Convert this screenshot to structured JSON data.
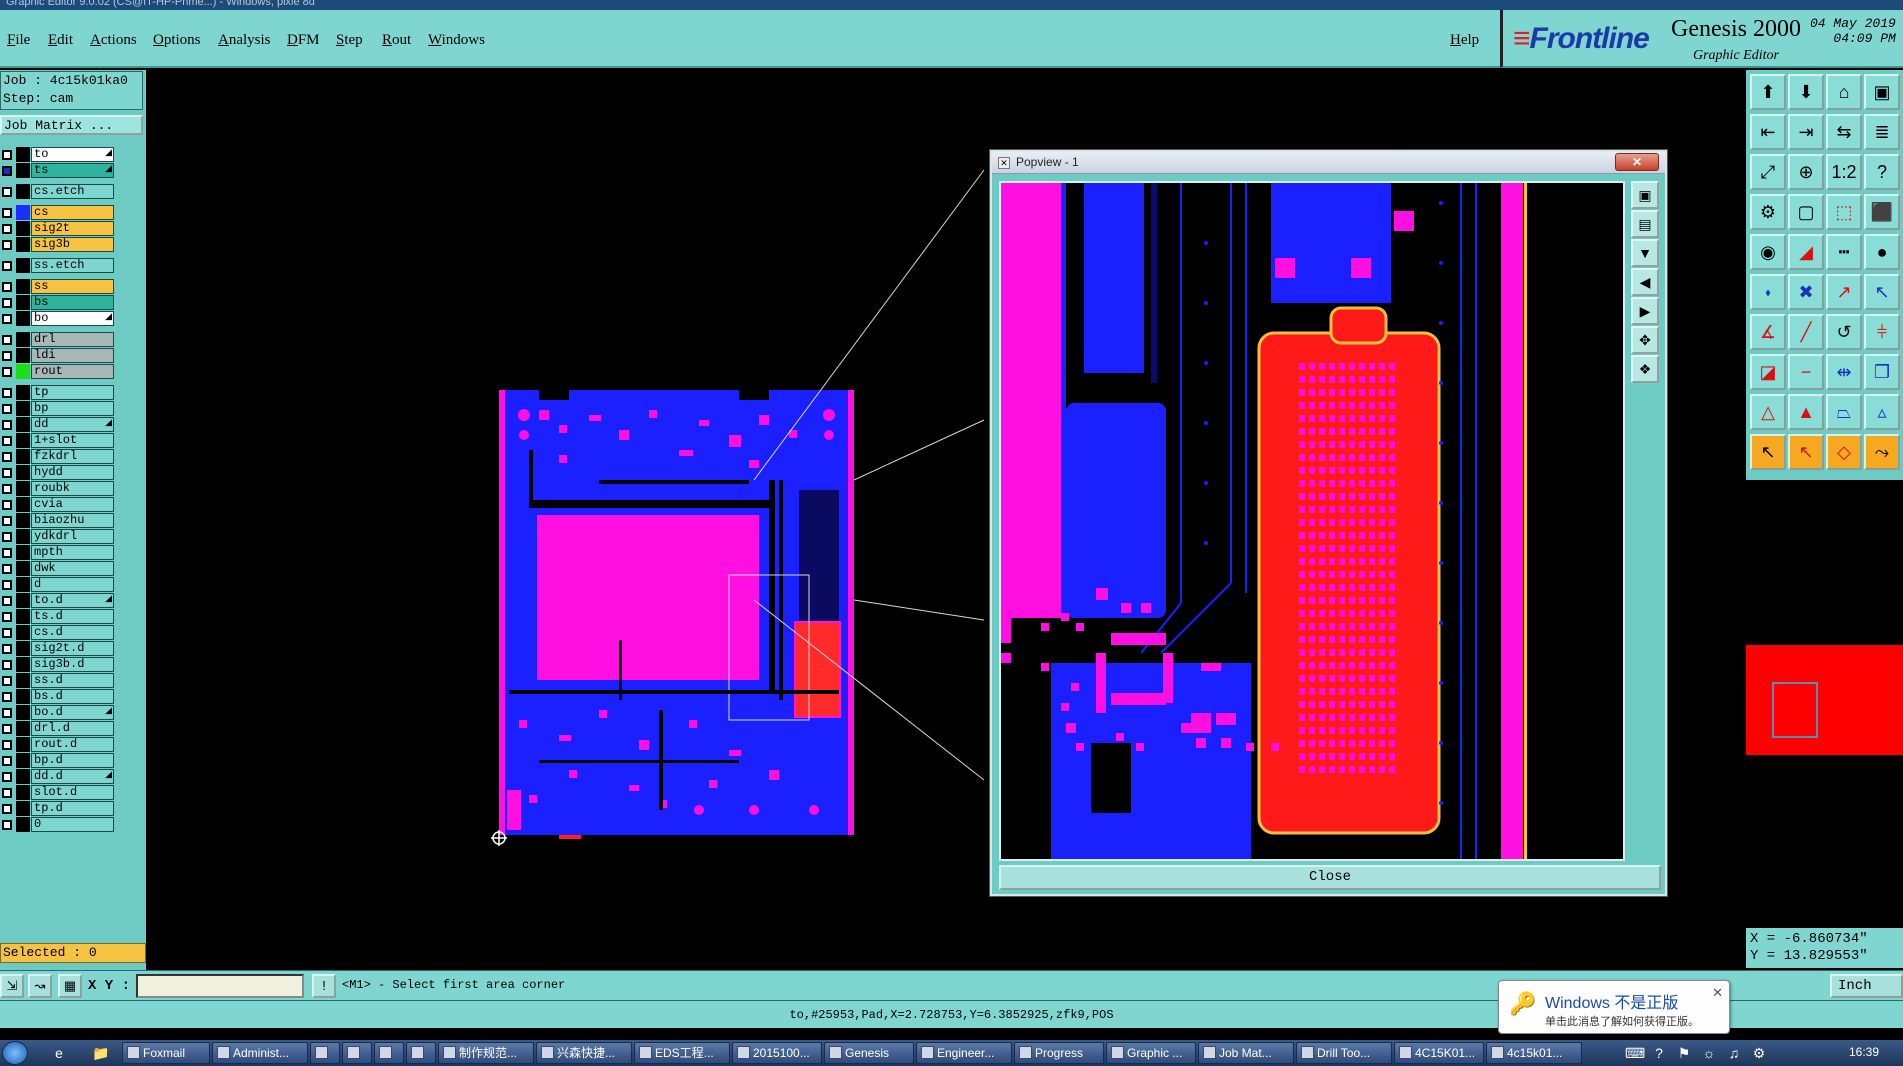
{
  "window": {
    "title": "Graphic Editor 9.0.02 (CS@IT-HP-Prime...) - Windows, pixie 8d"
  },
  "menu": [
    "File",
    "Edit",
    "Actions",
    "Options",
    "Analysis",
    "DFM",
    "Step",
    "Rout",
    "Windows"
  ],
  "help_label": "Help",
  "brand": {
    "logo": "Frontline",
    "product": "Genesis 2000",
    "subtitle": "Graphic Editor",
    "date": "04 May 2019",
    "time": "04:09 PM"
  },
  "job": {
    "job_line": "Job : 4c15k01ka0",
    "step_line": "Step: cam",
    "matrix_button": "Job Matrix ..."
  },
  "layers": [
    {
      "name": "to",
      "swatch": "#000000",
      "style": "wht",
      "arrow": true
    },
    {
      "name": "ts",
      "swatch": "#000000",
      "style": "grn",
      "arrow": true,
      "checked": true
    },
    {
      "name": "gap1",
      "gap": true
    },
    {
      "name": "cs.etch",
      "swatch": "#000000",
      "style": ""
    },
    {
      "name": "gap2",
      "gap": true
    },
    {
      "name": "cs",
      "swatch": "#1a30ff",
      "style": "yel"
    },
    {
      "name": "sig2t",
      "swatch": "#000000",
      "style": "yel"
    },
    {
      "name": "sig3b",
      "swatch": "#000000",
      "style": "yel"
    },
    {
      "name": "gap3",
      "gap": true
    },
    {
      "name": "ss.etch",
      "swatch": "#000000",
      "style": ""
    },
    {
      "name": "gap4",
      "gap": true
    },
    {
      "name": "ss",
      "swatch": "#000000",
      "style": "yel"
    },
    {
      "name": "bs",
      "swatch": "#000000",
      "style": "grn"
    },
    {
      "name": "bo",
      "swatch": "#000000",
      "style": "wht",
      "arrow": true
    },
    {
      "name": "gap5",
      "gap": true
    },
    {
      "name": "drl",
      "swatch": "#000000",
      "style": "gry"
    },
    {
      "name": "ldi",
      "swatch": "#000000",
      "style": "gry"
    },
    {
      "name": "rout",
      "swatch": "#19e019",
      "style": "gry"
    },
    {
      "name": "gap6",
      "gap": true
    },
    {
      "name": "tp",
      "swatch": "#000000",
      "style": ""
    },
    {
      "name": "bp",
      "swatch": "#000000",
      "style": ""
    },
    {
      "name": "dd",
      "swatch": "#000000",
      "style": "",
      "arrow": true
    },
    {
      "name": "1+slot",
      "swatch": "#000000",
      "style": ""
    },
    {
      "name": "fzkdrl",
      "swatch": "#000000",
      "style": ""
    },
    {
      "name": "hydd",
      "swatch": "#000000",
      "style": ""
    },
    {
      "name": "roubk",
      "swatch": "#000000",
      "style": ""
    },
    {
      "name": "cvia",
      "swatch": "#000000",
      "style": ""
    },
    {
      "name": "biaozhu",
      "swatch": "#000000",
      "style": ""
    },
    {
      "name": "ydkdrl",
      "swatch": "#000000",
      "style": ""
    },
    {
      "name": "mpth",
      "swatch": "#000000",
      "style": ""
    },
    {
      "name": "dwk",
      "swatch": "#000000",
      "style": ""
    },
    {
      "name": "d",
      "swatch": "#000000",
      "style": ""
    },
    {
      "name": "to.d",
      "swatch": "#000000",
      "style": "",
      "arrow": true
    },
    {
      "name": "ts.d",
      "swatch": "#000000",
      "style": ""
    },
    {
      "name": "cs.d",
      "swatch": "#000000",
      "style": ""
    },
    {
      "name": "sig2t.d",
      "swatch": "#000000",
      "style": ""
    },
    {
      "name": "sig3b.d",
      "swatch": "#000000",
      "style": ""
    },
    {
      "name": "ss.d",
      "swatch": "#000000",
      "style": ""
    },
    {
      "name": "bs.d",
      "swatch": "#000000",
      "style": ""
    },
    {
      "name": "bo.d",
      "swatch": "#000000",
      "style": "",
      "arrow": true
    },
    {
      "name": "drl.d",
      "swatch": "#000000",
      "style": ""
    },
    {
      "name": "rout.d",
      "swatch": "#000000",
      "style": ""
    },
    {
      "name": "bp.d",
      "swatch": "#000000",
      "style": ""
    },
    {
      "name": "dd.d",
      "swatch": "#000000",
      "style": "",
      "arrow": true
    },
    {
      "name": "slot.d",
      "swatch": "#000000",
      "style": ""
    },
    {
      "name": "tp.d",
      "swatch": "#000000",
      "style": ""
    },
    {
      "name": "0",
      "swatch": "#000000",
      "style": ""
    }
  ],
  "selected": "Selected : 0",
  "popview": {
    "title": "Popview - 1",
    "close_label": "Close"
  },
  "coords": {
    "x": "X = -6.860734\"",
    "y": "Y = 13.829553\""
  },
  "command": {
    "xy_label": "X Y :",
    "xy_value": "",
    "prompt": "<M1> - Select first area corner",
    "units": "Inch"
  },
  "status": "to,#25953,Pad,X=2.728753,Y=6.3852925,zfk9,POS",
  "notification": {
    "title": "Windows 不是正版",
    "subtitle": "单击此消息了解如何获得正版。"
  },
  "taskbar": {
    "items": [
      "Foxmail",
      "Administ...",
      "",
      "",
      "",
      "",
      "制作规范...",
      "兴森快捷...",
      "EDS工程...",
      "2015100...",
      "Genesis",
      "Engineer...",
      "Progress",
      "Graphic ...",
      "Job Mat...",
      "Drill Too...",
      "4C15K01...",
      "4c15k01..."
    ],
    "clock": "16:39"
  },
  "colors": {
    "accent": "#7fd6d0",
    "copper_blue": "#1a30ff",
    "pad_magenta": "#ff10e0",
    "red_highlight": "#ff0000"
  }
}
